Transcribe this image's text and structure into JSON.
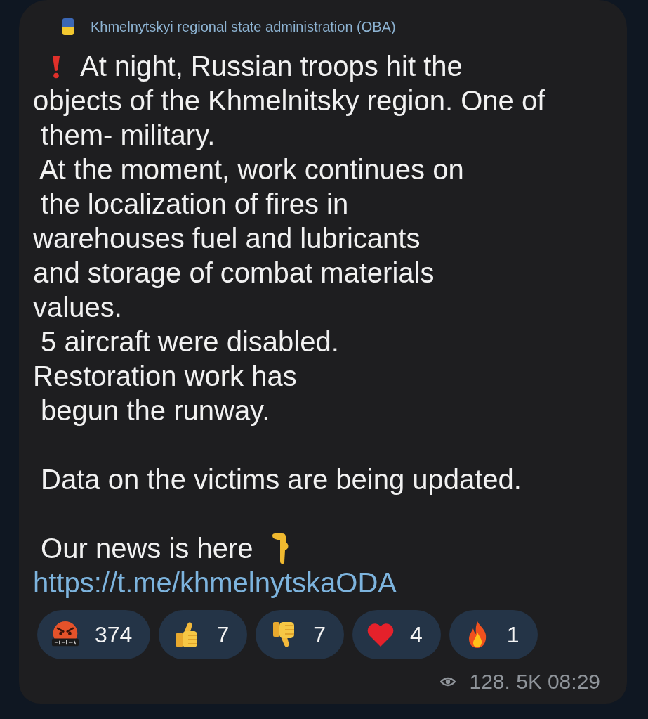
{
  "header": {
    "title": "Khmelnytskyi regional state administration (OBA)"
  },
  "message": {
    "blocks": [
      {
        "lines": [
          {
            "kind": "alert",
            "text": "At night, Russian troops hit the"
          },
          {
            "kind": "plain",
            "text": "objects of the Khmelnitsky region. One of"
          },
          {
            "kind": "plain",
            "text": " them- military."
          },
          {
            "kind": "plain",
            "text": " At the moment, work continues on"
          },
          {
            "kind": "plain",
            "text": " the localization of fires in"
          },
          {
            "kind": "plain",
            "text": "warehouses fuel and lubricants"
          },
          {
            "kind": "plain",
            "text": "and storage of combat materials"
          },
          {
            "kind": "plain",
            "text": "values."
          },
          {
            "kind": "plain",
            "text": " 5 aircraft were disabled."
          },
          {
            "kind": "plain",
            "text": "Restoration work has"
          },
          {
            "kind": "plain",
            "text": " begun the runway."
          }
        ]
      },
      {
        "lines": [
          {
            "kind": "plain",
            "text": " Data on the victims are being updated."
          }
        ]
      },
      {
        "lines": [
          {
            "kind": "pointer",
            "text": " Our news is here"
          },
          {
            "kind": "link",
            "text": "https://t.me/khmelnytskaODA"
          }
        ]
      }
    ]
  },
  "reactions": [
    {
      "kind": "angry",
      "count": "374"
    },
    {
      "kind": "thumbs_up",
      "count": "7"
    },
    {
      "kind": "thumbs_down",
      "count": "7"
    },
    {
      "kind": "heart",
      "count": "4"
    },
    {
      "kind": "fire",
      "count": "1"
    }
  ],
  "footer": {
    "views": "128. 5K",
    "time": "08:29"
  }
}
